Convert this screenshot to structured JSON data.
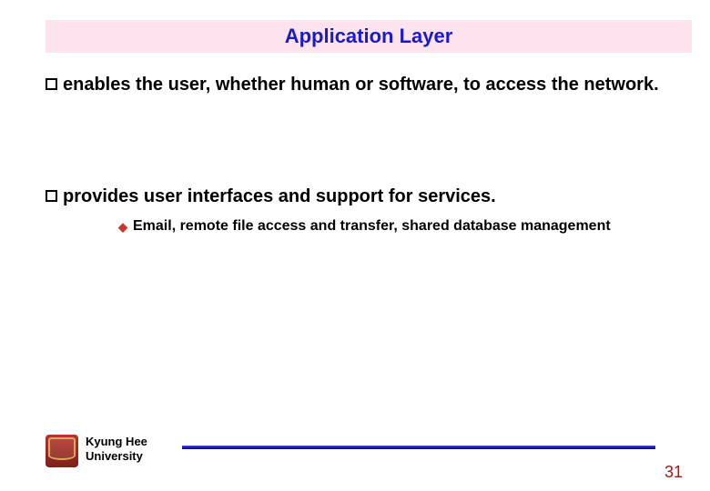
{
  "title": "Application Layer",
  "points": [
    {
      "text": "enables the user, whether human or software, to access the network."
    },
    {
      "text": "provides user interfaces and support for services.",
      "sub": "Email, remote file access and transfer, shared database management"
    }
  ],
  "footer": {
    "institution_line1": "Kyung Hee",
    "institution_line2": "University",
    "page_number": "31"
  }
}
